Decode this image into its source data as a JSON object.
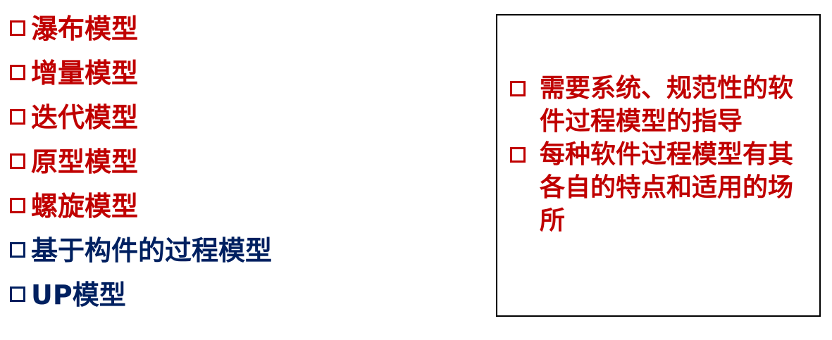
{
  "colors": {
    "red": "#c00000",
    "navy": "#002060",
    "border": "#000000"
  },
  "models": [
    {
      "label": "瀑布模型",
      "color": "red"
    },
    {
      "label": "增量模型",
      "color": "red"
    },
    {
      "label": "迭代模型",
      "color": "red"
    },
    {
      "label": "原型模型",
      "color": "red"
    },
    {
      "label": "螺旋模型",
      "color": "red"
    },
    {
      "label": "基于构件的过程模型",
      "color": "navy"
    },
    {
      "label": "UP模型",
      "color": "navy"
    }
  ],
  "notes": [
    {
      "text": "需要系统、规范性的软件过程模型的指导"
    },
    {
      "text": "每种软件过程模型有其各自的特点和适用的场所"
    }
  ]
}
